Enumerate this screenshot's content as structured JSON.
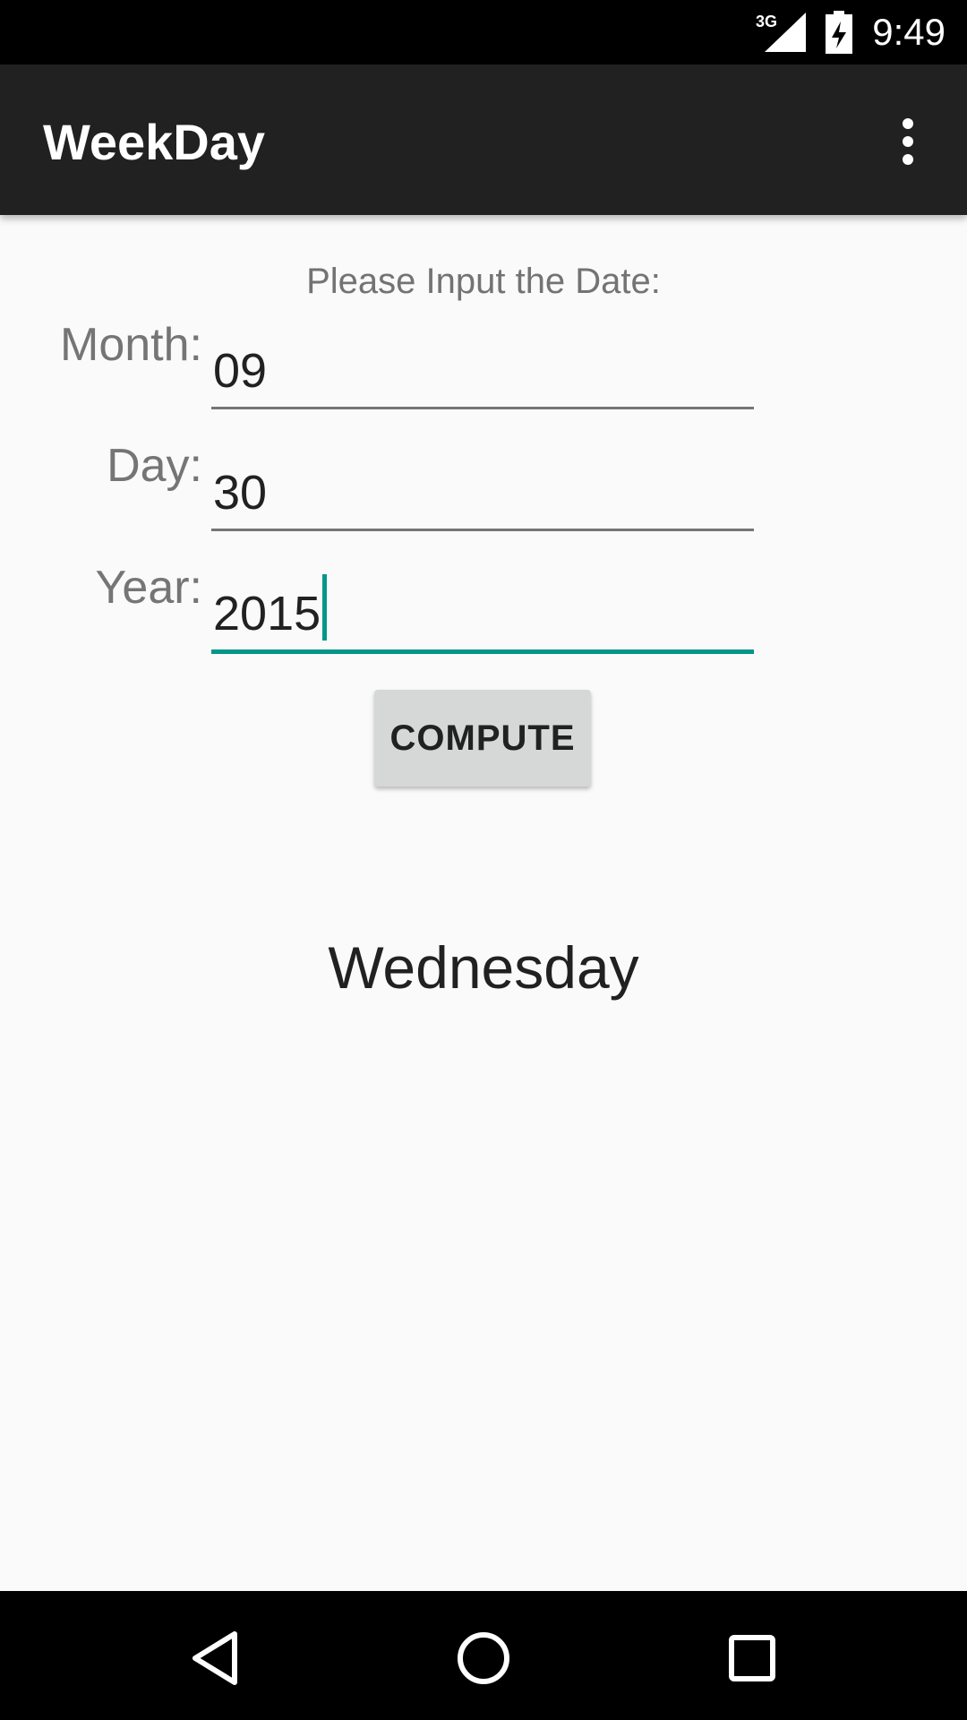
{
  "status_bar": {
    "network": "3G",
    "time": "9:49",
    "icons": [
      "signal-icon",
      "battery-charging-icon"
    ]
  },
  "app_bar": {
    "title": "WeekDay",
    "overflow_icon": "more-vert-icon"
  },
  "form": {
    "prompt": "Please Input the Date:",
    "month_label": "Month:",
    "month_value": "09",
    "day_label": "Day:",
    "day_value": "30",
    "year_label": "Year:",
    "year_value": "2015",
    "compute_label": "COMPUTE"
  },
  "result": "Wednesday",
  "nav_bar": {
    "icons": [
      "back-icon",
      "home-icon",
      "recents-icon"
    ]
  },
  "colors": {
    "accent": "#009688",
    "app_bar": "#212121",
    "background": "#fafafa",
    "button": "#d6d7d7"
  }
}
